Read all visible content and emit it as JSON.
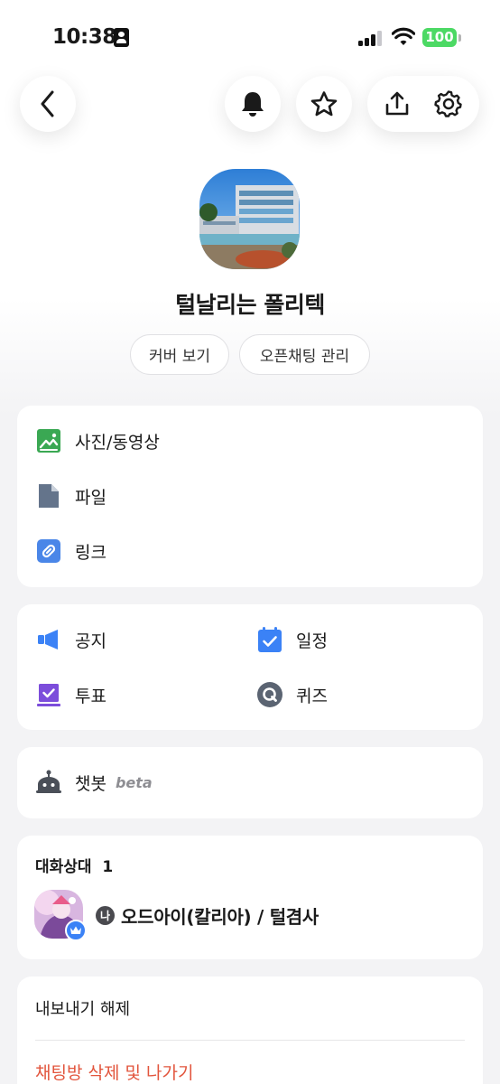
{
  "status_bar": {
    "time": "10:38",
    "battery": "100"
  },
  "header": {
    "back": "back-icon",
    "notifications": "bell-icon",
    "favorite": "star-icon",
    "share": "share-icon",
    "settings": "gear-icon"
  },
  "room": {
    "title": "털날리는 폴리텍",
    "chips": [
      "커버 보기",
      "오픈채팅 관리"
    ]
  },
  "media_menu": [
    {
      "label": "사진/동영상",
      "icon": "photo-icon",
      "color": "#3aa853"
    },
    {
      "label": "파일",
      "icon": "file-icon",
      "color": "#64748b"
    },
    {
      "label": "링크",
      "icon": "link-icon",
      "color": "#4a86e8"
    }
  ],
  "tools_menu": [
    {
      "label": "공지",
      "icon": "megaphone-icon"
    },
    {
      "label": "일정",
      "icon": "calendar-icon"
    },
    {
      "label": "투표",
      "icon": "vote-icon"
    },
    {
      "label": "퀴즈",
      "icon": "quiz-icon"
    }
  ],
  "chatbot": {
    "label": "챗봇",
    "badge": "beta",
    "icon": "robot-icon"
  },
  "members": {
    "title": "대화상대",
    "count": "1",
    "list": [
      {
        "me_badge": "나",
        "name": "오드아이(칼리아) / 털겸사",
        "role_icon": "crown-icon"
      }
    ]
  },
  "actions": {
    "export_label": "내보내기 해제",
    "delete_label": "채팅방 삭제 및 나가기"
  },
  "colors": {
    "accent_blue": "#3b82f6",
    "danger": "#e2553d",
    "battery_green": "#4cd964"
  }
}
